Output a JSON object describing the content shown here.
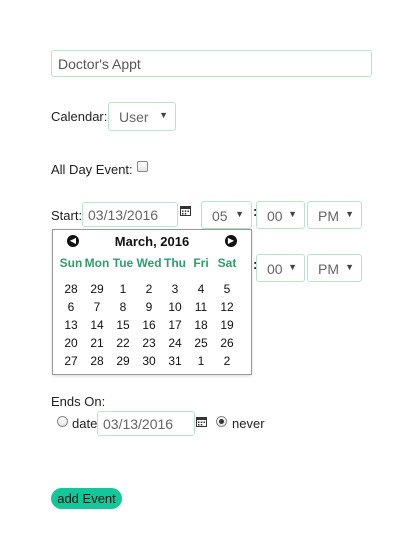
{
  "event_title": {
    "value": "Doctor's Appt"
  },
  "calendar": {
    "label": "Calendar:",
    "selected": "User"
  },
  "all_day": {
    "label": "All Day Event:",
    "checked": false
  },
  "start": {
    "label": "Start:",
    "date": "03/13/2016",
    "hour": "05",
    "minute": "00",
    "ampm": "PM"
  },
  "end": {
    "minute": "00",
    "ampm": "PM"
  },
  "colon": ":",
  "caret": "▼",
  "datepicker": {
    "month_title": "March, 2016",
    "prev": "◀",
    "next": "▶",
    "weekdays": [
      "Sun",
      "Mon",
      "Tue",
      "Wed",
      "Thu",
      "Fri",
      "Sat"
    ],
    "weeks": [
      [
        "28",
        "29",
        "1",
        "2",
        "3",
        "4",
        "5"
      ],
      [
        "6",
        "7",
        "8",
        "9",
        "10",
        "11",
        "12"
      ],
      [
        "13",
        "14",
        "15",
        "16",
        "17",
        "18",
        "19"
      ],
      [
        "20",
        "21",
        "22",
        "23",
        "24",
        "25",
        "26"
      ],
      [
        "27",
        "28",
        "29",
        "30",
        "31",
        "1",
        "2"
      ]
    ]
  },
  "ends_on": {
    "label": "Ends On:",
    "date_option_label": "date",
    "date_value": "03/13/2016",
    "never_label": "never",
    "selected": "never"
  },
  "add_button": {
    "label": "add Event",
    "color": "#14c79a"
  },
  "icons": {
    "calendar": "calendar-icon"
  }
}
